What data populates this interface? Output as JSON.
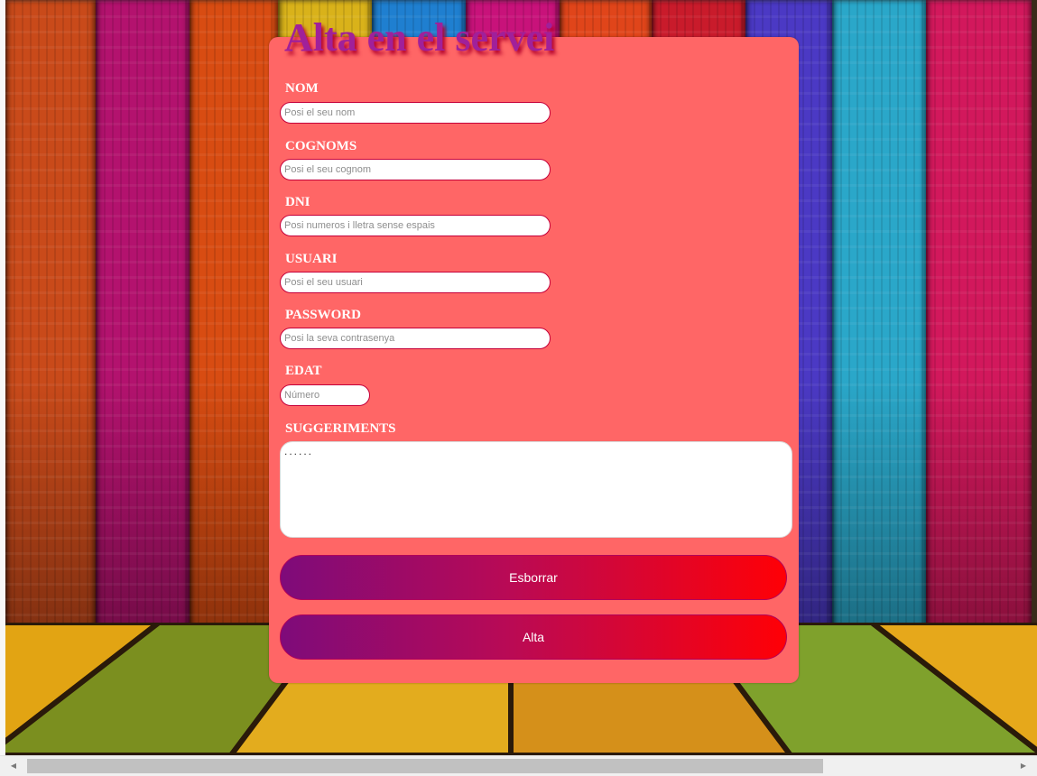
{
  "form": {
    "title": "Alta en el servei",
    "fields": {
      "nom": {
        "label": "NOM",
        "placeholder": "Posi el seu nom"
      },
      "cognoms": {
        "label": "COGNOMS",
        "placeholder": "Posi el seu cognom"
      },
      "dni": {
        "label": "DNI",
        "placeholder": "Posi numeros i lletra sense espais"
      },
      "usuari": {
        "label": "USUARI",
        "placeholder": "Posi el seu usuari"
      },
      "password": {
        "label": "PASSWORD",
        "placeholder": "Posi la seva contrasenya"
      },
      "edat": {
        "label": "EDAT",
        "placeholder": "Número"
      },
      "suggeriments": {
        "label": "SUGGERIMENTS",
        "value": "......"
      }
    },
    "buttons": {
      "reset_label": "Esborrar",
      "submit_label": "Alta"
    }
  },
  "colors": {
    "card_background": "#ff6666",
    "title_color": "#a0209a",
    "button_gradient_start": "#7e0b7a",
    "button_gradient_end": "#ff0006"
  },
  "background": {
    "wall_plank_colors": [
      "#c94a1a",
      "#b3126e",
      "#d84c12",
      "#d9b21a",
      "#1f7fd0",
      "#c8127a",
      "#e0451a",
      "#c91b2b",
      "#4b39c4",
      "#2aa7c9",
      "#d2185c"
    ],
    "floor_plank_colors": [
      "#e2a413",
      "#7b8f1f",
      "#e3ac1e",
      "#d5901a",
      "#7fa12c",
      "#e6a81b"
    ]
  }
}
